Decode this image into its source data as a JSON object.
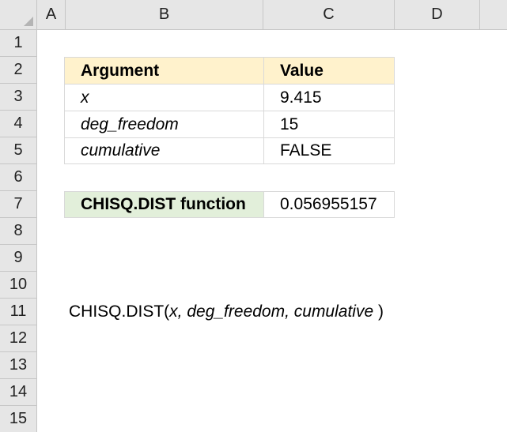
{
  "columns": [
    "A",
    "B",
    "C",
    "D"
  ],
  "rows": [
    "1",
    "2",
    "3",
    "4",
    "5",
    "6",
    "7",
    "8",
    "9",
    "10",
    "11",
    "12",
    "13",
    "14",
    "15"
  ],
  "table": {
    "header": {
      "argument": "Argument",
      "value": "Value"
    },
    "rows": [
      {
        "argument": "x",
        "value": "9.415"
      },
      {
        "argument": "deg_freedom",
        "value": "15"
      },
      {
        "argument": "cumulative",
        "value": "FALSE"
      }
    ]
  },
  "result": {
    "label": "CHISQ.DIST function",
    "value": "0.056955157"
  },
  "syntax": {
    "fn": "CHISQ.DIST(",
    "args": "x, deg_freedom, cumulative",
    "close": " )"
  },
  "colors": {
    "header_fill": "#fff2cc",
    "function_fill": "#e2efda",
    "grid_header": "#e6e6e6"
  }
}
